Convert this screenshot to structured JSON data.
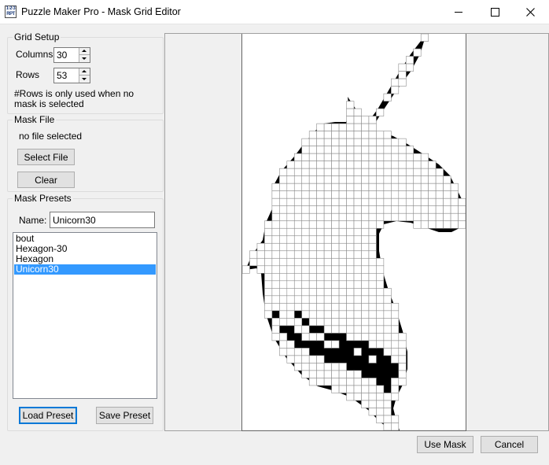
{
  "window": {
    "icon_text": "1 2 3\nRPT",
    "title": "Puzzle Maker Pro - Mask Grid Editor"
  },
  "grid_setup": {
    "title": "Grid Setup",
    "columns_label": "Columns",
    "columns_value": "30",
    "rows_label": "Rows",
    "rows_value": "53",
    "note": "#Rows is only used when no mask is selected"
  },
  "mask_file": {
    "title": "Mask File",
    "status": "no file selected",
    "select_label": "Select File",
    "clear_label": "Clear"
  },
  "mask_presets": {
    "title": "Mask Presets",
    "name_label": "Name:",
    "name_value": "Unicorn30",
    "items": [
      "bout",
      "Hexagon-30",
      "Hexagon",
      "Unicorn30"
    ],
    "selected_index": 3,
    "load_label": "Load Preset",
    "save_label": "Save Preset"
  },
  "mask_grid": {
    "columns": 30,
    "rows": 53,
    "fill_color": "#000000",
    "cell_color": "#ffffff",
    "line_color": "#8c8c8c"
  },
  "footer": {
    "use_mask_label": "Use Mask",
    "cancel_label": "Cancel"
  }
}
